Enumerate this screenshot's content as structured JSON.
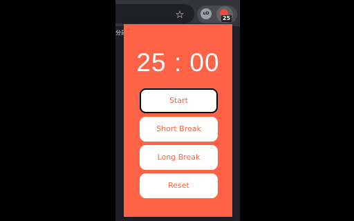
{
  "browser": {
    "star_icon": "star-icon",
    "ext_ud_label": "uD",
    "ext_badge": "25",
    "page_fragment_text": "分是"
  },
  "popup": {
    "timer": "25 : 00",
    "buttons": {
      "start": "Start",
      "short_break": "Short Break",
      "long_break": "Long Break",
      "reset": "Reset"
    }
  },
  "colors": {
    "popup_bg": "#ff6347",
    "button_bg": "#ffffff",
    "button_text": "#ff6347",
    "toolbar_bg": "#35363a"
  }
}
